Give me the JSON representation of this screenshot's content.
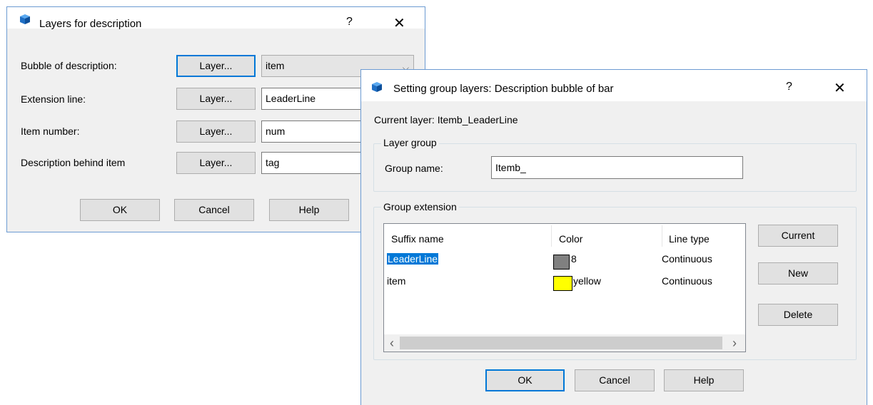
{
  "dialog1": {
    "title": "Layers for description",
    "help_glyph": "?",
    "close_glyph": "✕",
    "rows": [
      {
        "label": "Bubble of description:",
        "button": "Layer...",
        "value": "item"
      },
      {
        "label": "Extension line:",
        "button": "Layer...",
        "value": "LeaderLine"
      },
      {
        "label": "Item number:",
        "button": "Layer...",
        "value": "num"
      },
      {
        "label": "Description behind item",
        "button": "Layer...",
        "value": "tag"
      }
    ],
    "combo_chevron": "⌵",
    "ok": "OK",
    "cancel": "Cancel",
    "help": "Help"
  },
  "dialog2": {
    "title": "Setting group layers: Description bubble of bar",
    "help_glyph": "?",
    "close_glyph": "✕",
    "current_layer": "Current layer: Itemb_LeaderLine",
    "layer_group_caption": "Layer group",
    "group_name_label": "Group name:",
    "group_name_value": "Itemb_",
    "group_extension_caption": "Group extension",
    "columns": [
      "Suffix name",
      "Color",
      "Line type"
    ],
    "rows": [
      {
        "suffix": "LeaderLine",
        "color_name": "8",
        "color_hex": "#808080",
        "line_type": "Continuous",
        "selected": true
      },
      {
        "suffix": "item",
        "color_name": "yellow",
        "color_hex": "#ffff00",
        "line_type": "Continuous",
        "selected": false
      }
    ],
    "scroll_left": "‹",
    "scroll_right": "›",
    "current_btn": "Current",
    "new_btn": "New",
    "delete_btn": "Delete",
    "ok": "OK",
    "cancel": "Cancel",
    "help": "Help"
  },
  "colors": {
    "accent": "#0078d7",
    "dialog_bg": "#f0f0f0",
    "border": "#6c9bd2"
  }
}
